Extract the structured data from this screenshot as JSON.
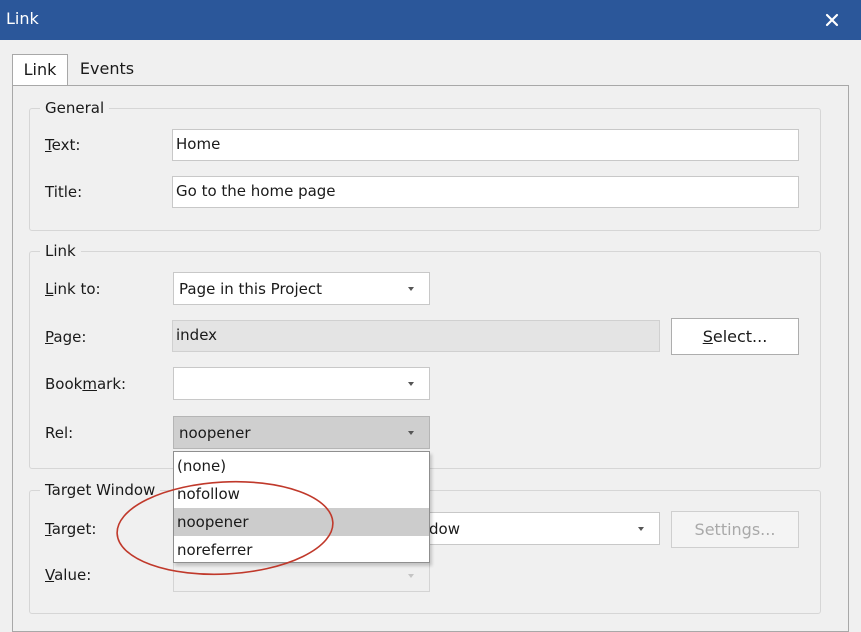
{
  "window": {
    "title": "Link",
    "close_glyph": "✕"
  },
  "tabs": [
    {
      "label": "Link",
      "active": true
    },
    {
      "label": "Events",
      "active": false
    }
  ],
  "general": {
    "legend": "General",
    "text_label": {
      "pre": "",
      "key": "T",
      "post": "ext:"
    },
    "text_value": "Home",
    "title_label": "Title:",
    "title_value": "Go to the home page"
  },
  "link": {
    "legend": "Link",
    "link_to_label": {
      "pre": "",
      "key": "L",
      "post": "ink to:"
    },
    "link_to_value": "Page in this Project",
    "page_label": {
      "pre": "",
      "key": "P",
      "post": "age:"
    },
    "page_value": "index",
    "select_button": {
      "pre": "",
      "key": "S",
      "post": "elect..."
    },
    "bookmark_label": {
      "pre": "Book",
      "key": "m",
      "post": "ark:"
    },
    "bookmark_value": "",
    "rel_label": "Rel:",
    "rel_value": "noopener"
  },
  "rel_dropdown": {
    "options": [
      "(none)",
      "nofollow",
      "noopener",
      "noreferrer"
    ],
    "highlighted": "noopener",
    "annotation_color": "#c0392b"
  },
  "target_window": {
    "legend": "Target Window",
    "target_label": {
      "pre": "",
      "key": "T",
      "post": "arget:"
    },
    "target_value_visible": "dow",
    "settings_button": "Settings...",
    "value_label": {
      "pre": "",
      "key": "V",
      "post": "alue:"
    },
    "value_value": ""
  },
  "colors": {
    "titlebar": "#2b579a",
    "highlight": "#cccccc"
  }
}
